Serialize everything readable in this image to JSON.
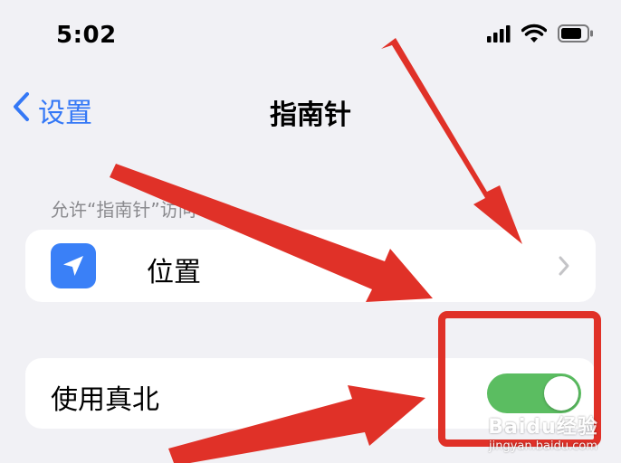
{
  "status_bar": {
    "time": "5:02",
    "icons": [
      "cellular-signal-icon",
      "wifi-icon",
      "battery-icon"
    ]
  },
  "nav": {
    "back_label": "设置",
    "title": "指南针"
  },
  "section": {
    "header": "允许“指南针”访问"
  },
  "rows": {
    "location": {
      "label": "位置",
      "icon": "location-arrow-icon"
    },
    "true_north": {
      "label": "使用真北",
      "toggle_on": true
    }
  },
  "watermark": {
    "logo": "Baidu经验",
    "url": "jingyan.baidu.com"
  },
  "colors": {
    "accent": "#3478f6",
    "toggle_on": "#5bbd61",
    "annotation_red": "#e03128",
    "background": "#f1f1f5"
  }
}
